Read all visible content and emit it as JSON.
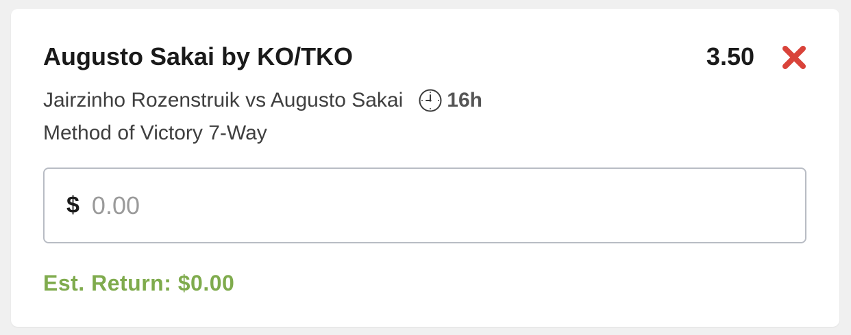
{
  "bet": {
    "selection": "Augusto Sakai by KO/TKO",
    "odds": "3.50",
    "matchup": "Jairzinho Rozenstruik vs Augusto Sakai",
    "time_left": "16h",
    "market": "Method of Victory 7-Way"
  },
  "stake": {
    "currency_symbol": "$",
    "placeholder": "0.00",
    "value": ""
  },
  "est_return": "Est. Return: $0.00",
  "icons": {
    "remove": "close-x-icon",
    "clock": "clock-icon"
  },
  "colors": {
    "remove": "#d9433a",
    "est_return": "#7fab4d",
    "input_border": "#b8bcc4"
  }
}
